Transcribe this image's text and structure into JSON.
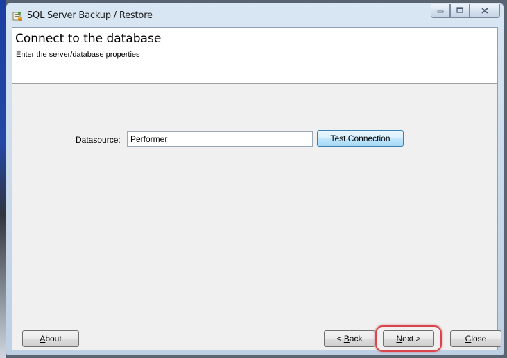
{
  "window": {
    "title": "SQL Server Backup / Restore",
    "controls": {
      "minimize": "▭",
      "maximize": "□",
      "close": "✕"
    }
  },
  "header": {
    "title": "Connect to the database",
    "subtitle": "Enter the server/database properties"
  },
  "form": {
    "datasource_label": "Datasource:",
    "datasource_value": "Performer",
    "test_connection_label": "Test Connection"
  },
  "footer": {
    "about": {
      "mnemonic": "A",
      "rest": "bout"
    },
    "back": {
      "prefix": "< ",
      "mnemonic": "B",
      "rest": "ack"
    },
    "next": {
      "mnemonic": "N",
      "rest": "ext >"
    },
    "close": {
      "mnemonic": "C",
      "rest": "lose"
    }
  },
  "annotations": {
    "highlight_color": "#d9454a",
    "highlighted_control": "next-button"
  },
  "icons": {
    "app": "app-database-icon",
    "minimize": "minimize-icon",
    "maximize": "maximize-icon",
    "close": "close-icon"
  }
}
